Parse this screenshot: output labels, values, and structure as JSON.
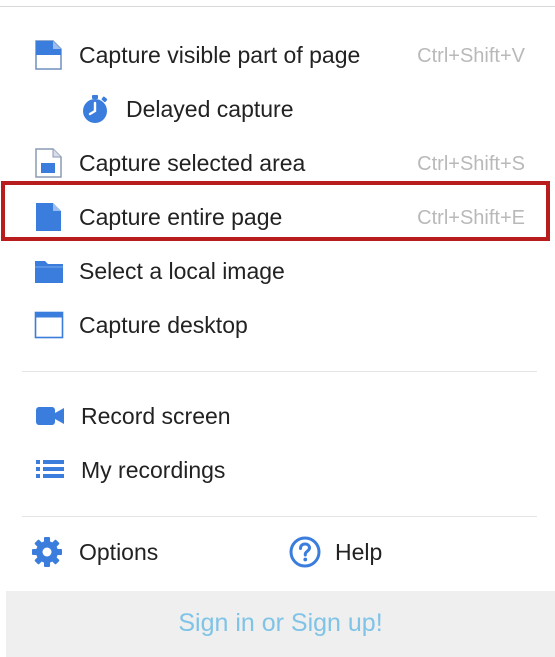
{
  "menu": {
    "items": [
      {
        "label": "Capture visible part of page",
        "shortcut": "Ctrl+Shift+V",
        "icon": "page-visible-icon"
      },
      {
        "label": "Delayed capture",
        "shortcut": "",
        "icon": "timer-icon"
      },
      {
        "label": "Capture selected area",
        "shortcut": "Ctrl+Shift+S",
        "icon": "page-area-icon"
      },
      {
        "label": "Capture entire page",
        "shortcut": "Ctrl+Shift+E",
        "icon": "page-full-icon"
      },
      {
        "label": "Select a local image",
        "shortcut": "",
        "icon": "folder-icon"
      },
      {
        "label": "Capture desktop",
        "shortcut": "",
        "icon": "window-icon"
      }
    ],
    "record_items": [
      {
        "label": "Record screen",
        "icon": "video-camera-icon"
      },
      {
        "label": "My recordings",
        "icon": "list-icon"
      }
    ]
  },
  "footer": {
    "options_label": "Options",
    "help_label": "Help",
    "signin_label": "Sign in or Sign up!"
  },
  "colors": {
    "icon_blue": "#3b7ddd",
    "highlight_red": "#b81c1c",
    "shortcut_gray": "#b9b9b9",
    "signin_blue": "#7fc3e6",
    "signin_bg": "#efefef"
  }
}
